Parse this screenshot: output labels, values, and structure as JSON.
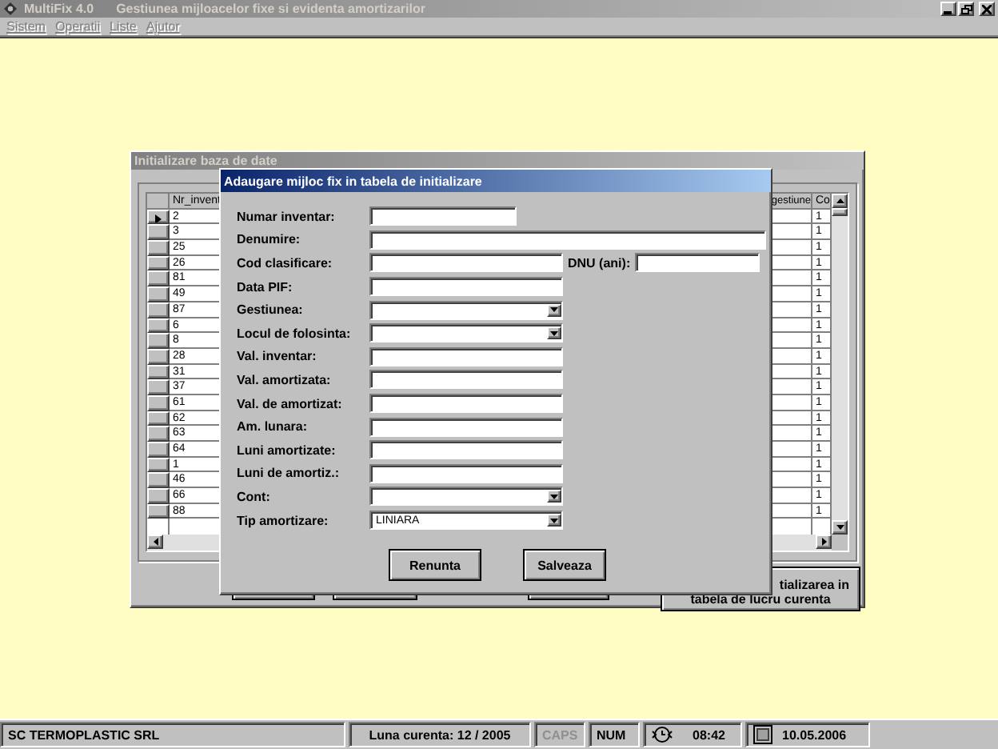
{
  "main_window": {
    "title": "MultiFix 4.0",
    "subtitle": "Gestiunea mijloacelor fixe si evidenta amortizarilor",
    "active": false
  },
  "menu": [
    {
      "label": "Sistem",
      "disabled": true
    },
    {
      "label": "Operatii",
      "disabled": true
    },
    {
      "label": "Liste",
      "disabled": true
    },
    {
      "label": "Ajutor",
      "disabled": true
    }
  ],
  "init_window": {
    "title": "Initializare baza de date",
    "active": false,
    "grid": {
      "columns": [
        "Nr_invent",
        "gestiune",
        "Co"
      ],
      "rows": [
        {
          "nr": "2",
          "col_3": "1",
          "selected": true
        },
        {
          "nr": "3",
          "col_3": "1",
          "selected": false
        },
        {
          "nr": "25",
          "col_3": "1",
          "selected": false
        },
        {
          "nr": "26",
          "col_3": "1",
          "selected": false
        },
        {
          "nr": "81",
          "col_3": "1",
          "selected": false
        },
        {
          "nr": "49",
          "col_3": "1",
          "selected": false
        },
        {
          "nr": "87",
          "col_3": "1",
          "selected": false
        },
        {
          "nr": "6",
          "col_3": "1",
          "selected": false
        },
        {
          "nr": "8",
          "col_3": "1",
          "selected": false
        },
        {
          "nr": "28",
          "col_3": "1",
          "selected": false
        },
        {
          "nr": "31",
          "col_3": "1",
          "selected": false
        },
        {
          "nr": "37",
          "col_3": "1",
          "selected": false
        },
        {
          "nr": "61",
          "col_3": "1",
          "selected": false
        },
        {
          "nr": "62",
          "col_3": "1",
          "selected": false
        },
        {
          "nr": "63",
          "col_3": "1",
          "selected": false
        },
        {
          "nr": "64",
          "col_3": "1",
          "selected": false
        },
        {
          "nr": "1",
          "col_3": "1",
          "selected": false
        },
        {
          "nr": "46",
          "col_3": "1",
          "selected": false
        },
        {
          "nr": "66",
          "col_3": "1",
          "selected": false
        },
        {
          "nr": "88",
          "col_3": "1",
          "selected": false
        }
      ]
    },
    "buttons": [
      {
        "kind": "covered"
      },
      {
        "kind": "covered"
      },
      {
        "kind": "covered"
      },
      {
        "kind": "labeled",
        "lines": [
          "tializarea in",
          "tabela de lucru curenta"
        ]
      }
    ]
  },
  "dialog": {
    "title": "Adaugare mijloc fix in tabela de initializare",
    "active": true,
    "fields": [
      {
        "label": "Numar inventar:",
        "kind": "short"
      },
      {
        "label": "Denumire:",
        "kind": "long"
      },
      {
        "label": "Cod clasificare:",
        "kind": "text",
        "side": {
          "label": "DNU (ani):"
        }
      },
      {
        "label": "Data PIF:",
        "kind": "text"
      },
      {
        "label": "Gestiunea:",
        "kind": "combo"
      },
      {
        "label": "Locul de folosinta:",
        "kind": "combo"
      },
      {
        "label": "Val. inventar:",
        "kind": "text"
      },
      {
        "label": "Val. amortizata:",
        "kind": "text"
      },
      {
        "label": "Val. de amortizat:",
        "kind": "text"
      },
      {
        "label": "Am. lunara:",
        "kind": "text"
      },
      {
        "label": "Luni amortizate:",
        "kind": "text"
      },
      {
        "label": "Luni de amortiz.:",
        "kind": "text"
      },
      {
        "label": "Cont:",
        "kind": "combo"
      },
      {
        "label": "Tip amortizare:",
        "kind": "combo",
        "value": "LINIARA"
      }
    ],
    "buttons": [
      "Renunta",
      "Salveaza"
    ]
  },
  "status_bar": [
    {
      "kind": "text",
      "text": "SC TERMOPLASTIC SRL"
    },
    {
      "kind": "text",
      "text": "Luna curenta: 12 / 2005"
    },
    {
      "kind": "indicator",
      "text": "CAPS",
      "on": false
    },
    {
      "kind": "indicator",
      "text": "NUM",
      "on": true
    },
    {
      "kind": "clock",
      "text": "08:42"
    },
    {
      "kind": "date",
      "text": "10.05.2006"
    }
  ]
}
